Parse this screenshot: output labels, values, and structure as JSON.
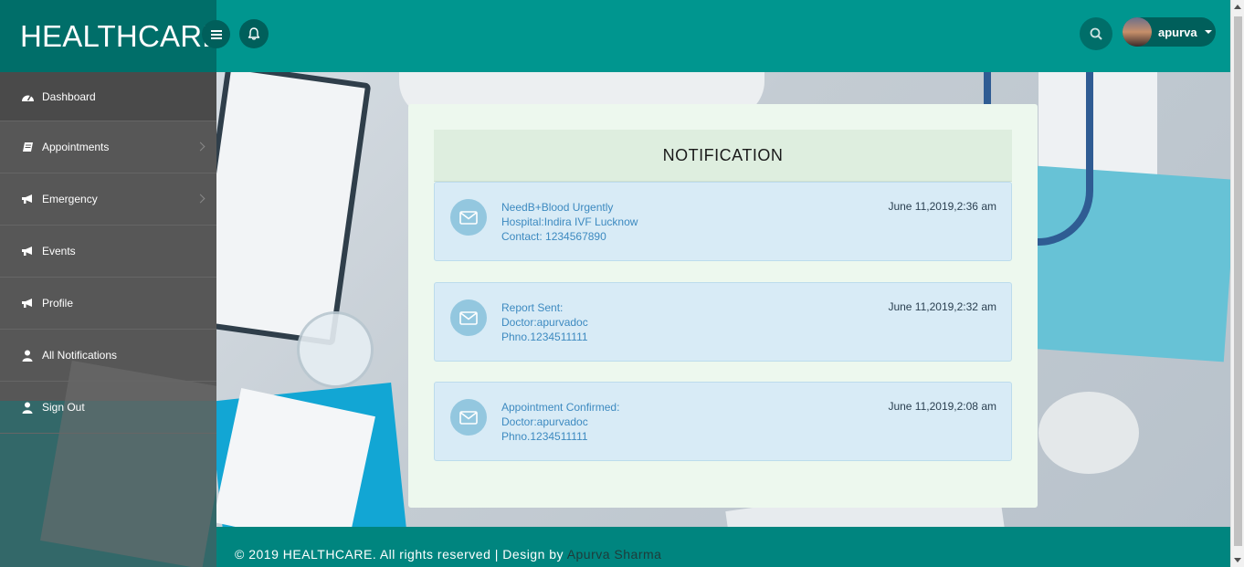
{
  "brand": "HEALTHCARE",
  "user": {
    "name": "apurva"
  },
  "sidebar": {
    "items": [
      {
        "label": "Dashboard",
        "icon": "dashboard-icon"
      },
      {
        "label": "Appointments",
        "icon": "book-icon"
      },
      {
        "label": "Emergency",
        "icon": "bullhorn-icon"
      },
      {
        "label": "Events",
        "icon": "bullhorn-icon"
      },
      {
        "label": "Profile",
        "icon": "bullhorn-icon"
      },
      {
        "label": "All Notifications",
        "icon": "user-icon"
      },
      {
        "label": "Sign Out",
        "icon": "user-icon"
      }
    ]
  },
  "panel": {
    "title": "NOTIFICATION",
    "notifications": [
      {
        "lines": [
          "NeedB+Blood Urgently",
          "Hospital:Indira IVF Lucknow",
          "Contact: 1234567890"
        ],
        "time": "June 11,2019,2:36 am"
      },
      {
        "lines": [
          "Report Sent:",
          "Doctor:apurvadoc",
          "Phno.1234511111"
        ],
        "time": "June 11,2019,2:32 am"
      },
      {
        "lines": [
          "Appointment Confirmed:",
          "Doctor:apurvadoc",
          "Phno.1234511111"
        ],
        "time": "June 11,2019,2:08 am"
      }
    ]
  },
  "footer": {
    "text": "© 2019 HEALTHCARE. All rights reserved | Design by",
    "author": "Apurva Sharma"
  },
  "colors": {
    "primary": "#00968f",
    "brand_bg": "#006e69",
    "sidebar": "#575757",
    "panel": "#edf8ee",
    "notif": "#d8ebf6"
  }
}
